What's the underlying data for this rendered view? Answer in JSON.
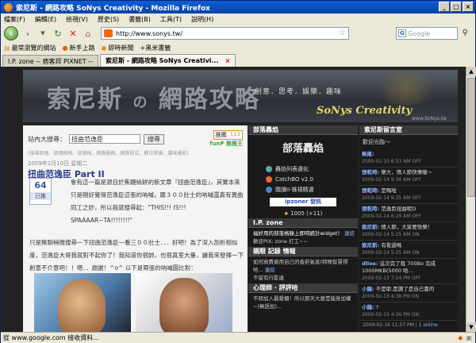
{
  "window": {
    "title": "索尼斯 - 網路攻略 SoNys Creativity - Mozilla Firefox"
  },
  "menu": [
    "檔案(F)",
    "編輯(E)",
    "檢視(V)",
    "歷史(S)",
    "書籤(B)",
    "工具(T)",
    "說明(H)"
  ],
  "toolbar": {
    "url": "http://www.sonys.tw/",
    "search_placeholder": "Google"
  },
  "bookmarks": [
    "最常瀏覽的網站",
    "新手上路",
    "即時新聞",
    "+黑米書籤"
  ],
  "tabs": [
    {
      "label": "I.P. zone -- 痞客邦 PIXNET --",
      "active": false
    },
    {
      "label": "索尼斯 - 網路攻略 SoNys Creativi...",
      "active": true
    }
  ],
  "banner": {
    "title": "索尼斯",
    "title_small": "の",
    "title_rest": "網路攻略",
    "slogan": "創意．思考．娛樂．趣味",
    "brand": "SoNys Creativity",
    "site": "www.SoNys.tw"
  },
  "search": {
    "label": "站內大搜尋：",
    "value": "扭曲范逸臣",
    "button": "搜尋",
    "hint": "(搜尋部落、部落格格、部落格、網路服務、網路程式、數位密碼、趣味攝影)",
    "gnc_label": "推薦",
    "gnc_count": "113",
    "funp": "funP 推推王"
  },
  "post": {
    "date": "2009年2月10日 星期二",
    "title": "扭曲范逸臣 Part II",
    "votes": "64",
    "vote_label": "已推",
    "p1": "會有這一篇是源自於焦糖絲餅的新文章『扭曲范逸臣』，其實本來只是剛好覺得范逸臣這張的吶喊，跟３００壯士的吶喊還真有異曲同工之妙，所以我就搜尋起：\"THIS!!! IS!!! SPAAAAR~TA!!!!!!!!\"",
    "p1_link": "扭曲范逸臣",
    "p2": "只是無聊稍微搜尋一下扭曲范逸臣一看三００壯士．．．好吧！為了深入剖析相似度，范逸臣大哥我就對不起你了！我知道你很帥，也很真室大量，讓我來發揮一下創意不介意吧！！嗯．．謝謝！^o^ 以下是兩張的吶喊圖比對："
  },
  "mid": {
    "section1": "部落轟焰",
    "logo_text": "部落轟焰",
    "items": [
      "轟焰列表選化",
      "CatchBO v2.0",
      "閱讀II-推視精選"
    ],
    "ipzoner": "ipzoner 發訊",
    "stat": "1005 (+11)",
    "section2": "I.P. zone",
    "news1_prefix": "福好用的部落格錄上即時統計widget！",
    "news1_link": "連結",
    "news1_suffix": "歡迎PIX: zone 打工~~",
    "section3": "親眼 記錄 情報",
    "news2": "如何寫費資用自己的香菸氣息(特殊智慧得哈...",
    "news2_link": "連結",
    "news2_b": "不留有行影速",
    "section4": "心理師 · 評評哈",
    "news3": "不問加入最愛櫃！所以那天大廈是能身加權~(無語加)..."
  },
  "right": {
    "section": "索尼斯留言室",
    "header": "歡迎光臨～",
    "messages": [
      {
        "name": "無尾:",
        "text": "",
        "time": "2009-02-15 6:53 AM OFF"
      },
      {
        "name": "張乾時:",
        "text": "樂大，情人節快樂喔～",
        "time": "2009-02-14 9:36 AM OFF"
      },
      {
        "name": "張乾時:",
        "text": "是嗎啦",
        "time": "2009-02-14 9:35 AM OFF"
      },
      {
        "name": "張乾時:",
        "text": "范逸臣扭曲呢D",
        "time": "2009-02-14 6:29 AM OFF"
      },
      {
        "name": "索尼斯:",
        "text": "情人節，大家要快樂！",
        "time": "2009-02-14 5:25 AM ON"
      },
      {
        "name": "索尼斯:",
        "text": "有看過嗎",
        "time": "2009-02-14 5:25 AM ON"
      },
      {
        "name": "dllee:",
        "text": "這次完了我 700Bo 完成 1000MKB(5000 哈...",
        "time": "2009-02-13 7:24 PM OFF"
      },
      {
        "name": "小龍:",
        "text": "不是耶,是讚了是自己書的",
        "time": "2009-02-13 4:38 PM ON"
      },
      {
        "name": "小龍:",
        "text": "?",
        "time": "2009-02-13 4:36 PM ON"
      }
    ],
    "footer_time": "2009-02-16 11:57 PM",
    "footer_online": "1 online"
  },
  "status": {
    "text": "從 www.google.com 接收資料..."
  }
}
